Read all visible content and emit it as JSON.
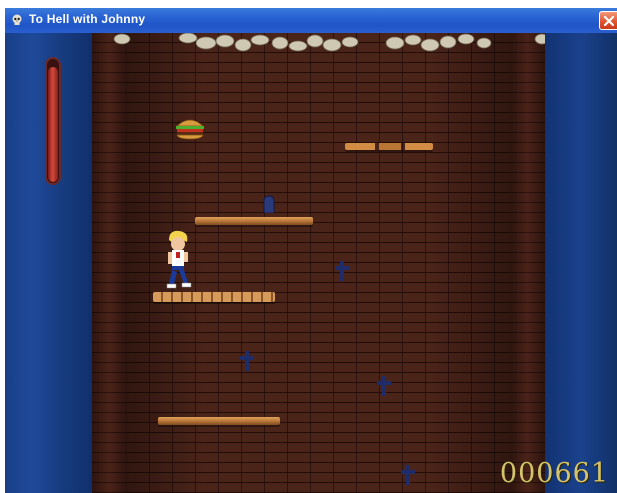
{
  "window": {
    "title": "To Hell with Johnny"
  },
  "hud": {
    "score": "000661",
    "health_fraction": 0.94
  },
  "icons": {
    "title_icon": "skull-icon",
    "close_icon": "close-icon"
  },
  "colors": {
    "titlebar": "#2a63d3",
    "close_button": "#e0502c",
    "score_text": "#d4c36a",
    "health_bar": "#d24a3a",
    "platform": "#b9773a",
    "brick": "#4a2319",
    "side_panel": "#1f4a9a"
  },
  "scene": {
    "player": "johnny-sprite",
    "pickup": "hamburger-icon",
    "hazard": "grave-cross-icon",
    "enemy": "tombstone-icon"
  }
}
